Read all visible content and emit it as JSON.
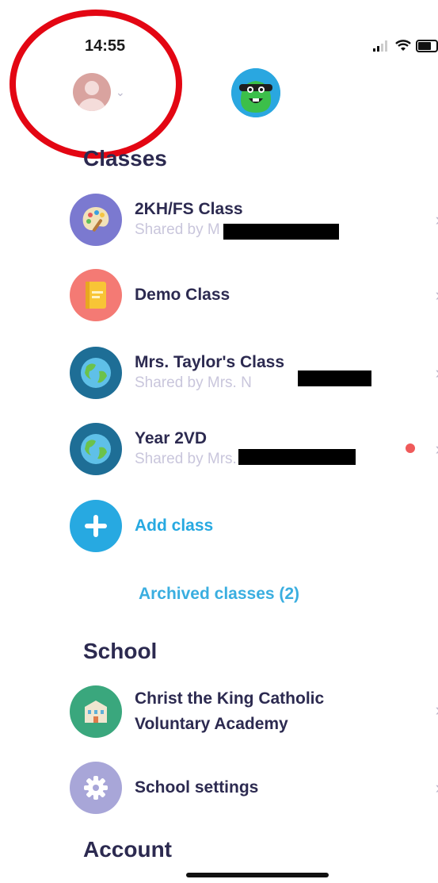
{
  "status_bar": {
    "time": "14:55"
  },
  "header": {
    "avatar_icon": "person-avatar-icon",
    "monster_icon": "classdojo-monster-icon",
    "annotation_color": "#e30613"
  },
  "classes": {
    "title": "Classes",
    "items": [
      {
        "name": "2KH/FS Class",
        "shared": "Shared by M",
        "icon": "palette-icon",
        "icon_bg": "#7b79d0"
      },
      {
        "name": "Demo Class",
        "shared": "",
        "icon": "notebook-icon",
        "icon_bg": "#f47a74"
      },
      {
        "name": "Mrs. Taylor's Class",
        "shared": "Shared by Mrs. N",
        "icon": "globe-icon",
        "icon_bg": "#1e6e96"
      },
      {
        "name": "Year 2VD",
        "shared": "Shared by Mrs.",
        "icon": "globe-icon",
        "icon_bg": "#1e6e96"
      }
    ],
    "add_label": "Add class",
    "archived_label": "Archived classes (2)"
  },
  "school": {
    "title": "School",
    "name_line1": "Christ the King Catholic",
    "name_line2": "Voluntary Academy",
    "settings_label": "School settings"
  },
  "account": {
    "title": "Account"
  }
}
